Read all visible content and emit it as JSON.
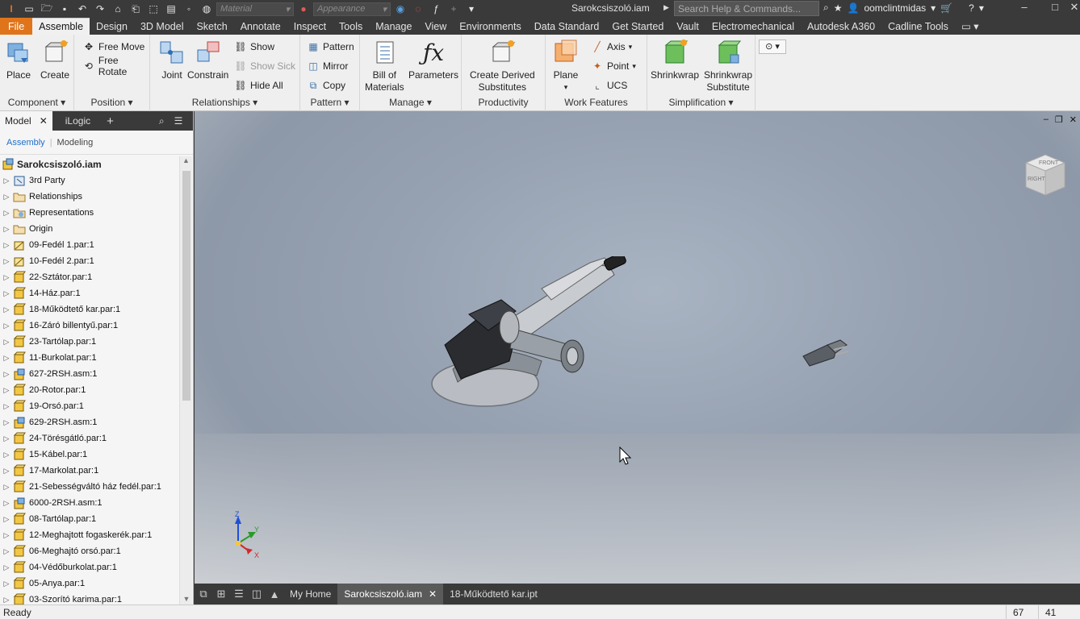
{
  "titlebar": {
    "material_placeholder": "Material",
    "appearance_placeholder": "Appearance",
    "document_title": "Sarokcsiszoló.iam",
    "search_placeholder": "Search Help & Commands...",
    "username": "oomclintmidas"
  },
  "ribbon_tabs": [
    "File",
    "Assemble",
    "Design",
    "3D Model",
    "Sketch",
    "Annotate",
    "Inspect",
    "Tools",
    "Manage",
    "View",
    "Environments",
    "Data Standard",
    "Get Started",
    "Vault",
    "Electromechanical",
    "Autodesk A360",
    "Cadline Tools"
  ],
  "ribbon": {
    "component": {
      "label": "Component",
      "place": "Place",
      "create": "Create"
    },
    "position": {
      "label": "Position",
      "free_move": "Free Move",
      "free_rotate": "Free Rotate"
    },
    "relationships": {
      "label": "Relationships",
      "joint": "Joint",
      "constrain": "Constrain",
      "show": "Show",
      "show_sick": "Show Sick",
      "hide_all": "Hide All"
    },
    "pattern": {
      "label": "Pattern",
      "pattern": "Pattern",
      "mirror": "Mirror",
      "copy": "Copy"
    },
    "manage": {
      "label": "Manage",
      "bom_line1": "Bill of",
      "bom_line2": "Materials",
      "parameters": "Parameters"
    },
    "productivity": {
      "label": "Productivity",
      "cds_line1": "Create Derived",
      "cds_line2": "Substitutes"
    },
    "work_features": {
      "label": "Work Features",
      "plane": "Plane",
      "axis": "Axis",
      "point": "Point",
      "ucs": "UCS"
    },
    "simplification": {
      "label": "Simplification",
      "shrinkwrap": "Shrinkwrap",
      "sws_line1": "Shrinkwrap",
      "sws_line2": "Substitute"
    }
  },
  "browser": {
    "tab_model": "Model",
    "tab_ilogic": "iLogic",
    "mode_assembly": "Assembly",
    "mode_modeling": "Modeling",
    "root": "Sarokcsiszoló.iam",
    "items": [
      {
        "label": "3rd Party",
        "icon": "third-party"
      },
      {
        "label": "Relationships",
        "icon": "folder"
      },
      {
        "label": "Representations",
        "icon": "representations"
      },
      {
        "label": "Origin",
        "icon": "folder"
      },
      {
        "label": "09-Fedél 1.par:1",
        "icon": "part-special"
      },
      {
        "label": "10-Fedél 2.par:1",
        "icon": "part-special"
      },
      {
        "label": "22-Sztátor.par:1",
        "icon": "part"
      },
      {
        "label": "14-Ház.par:1",
        "icon": "part"
      },
      {
        "label": "18-Működtető kar.par:1",
        "icon": "part"
      },
      {
        "label": "16-Záró billentyű.par:1",
        "icon": "part"
      },
      {
        "label": "23-Tartólap.par:1",
        "icon": "part"
      },
      {
        "label": "11-Burkolat.par:1",
        "icon": "part"
      },
      {
        "label": "627-2RSH.asm:1",
        "icon": "assembly"
      },
      {
        "label": "20-Rotor.par:1",
        "icon": "part"
      },
      {
        "label": "19-Orsó.par:1",
        "icon": "part"
      },
      {
        "label": "629-2RSH.asm:1",
        "icon": "assembly"
      },
      {
        "label": "24-Törésgátló.par:1",
        "icon": "part"
      },
      {
        "label": "15-Kábel.par:1",
        "icon": "part"
      },
      {
        "label": "17-Markolat.par:1",
        "icon": "part"
      },
      {
        "label": "21-Sebességváltó ház fedél.par:1",
        "icon": "part"
      },
      {
        "label": "6000-2RSH.asm:1",
        "icon": "assembly"
      },
      {
        "label": "08-Tartólap.par:1",
        "icon": "part"
      },
      {
        "label": "12-Meghajtott fogaskerék.par:1",
        "icon": "part"
      },
      {
        "label": "06-Meghajtó orsó.par:1",
        "icon": "part"
      },
      {
        "label": "04-Védőburkolat.par:1",
        "icon": "part"
      },
      {
        "label": "05-Anya.par:1",
        "icon": "part"
      },
      {
        "label": "03-Szorító karima.par:1",
        "icon": "part"
      }
    ]
  },
  "viewcube": {
    "front": "FRONT",
    "right": "RIGHT"
  },
  "doc_tabs": {
    "home": "My Home",
    "active": "Sarokcsiszoló.iam",
    "other": "18-Működtető kar.ipt"
  },
  "statusbar": {
    "text": "Ready",
    "count1": "67",
    "count2": "41"
  },
  "colors": {
    "file_tab": "#e0741a",
    "accent_blue": "#1e6fc9",
    "part_yellow": "#f2c744"
  }
}
